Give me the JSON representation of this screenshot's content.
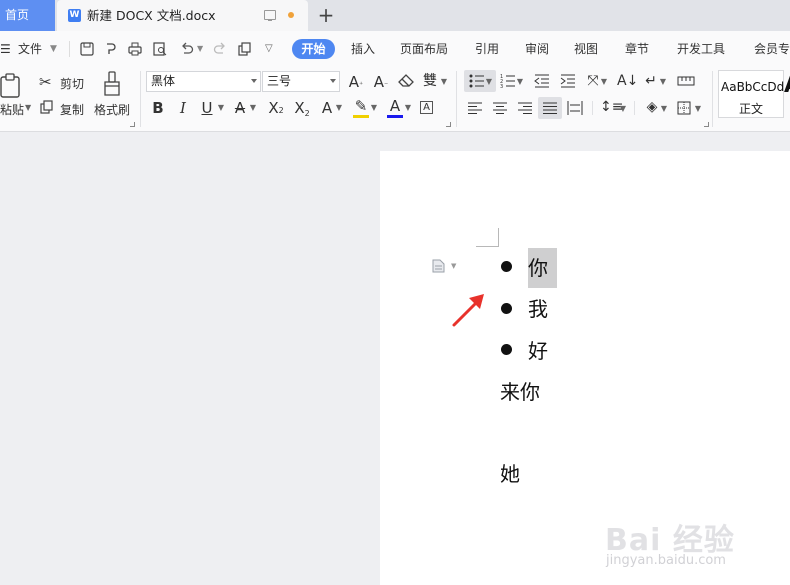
{
  "tabs": {
    "home": "首页",
    "doc_icon_letter": "W",
    "doc_title": "新建 DOCX 文档.docx",
    "new_tab": "+"
  },
  "menu": {
    "file": "文件",
    "tabs": [
      "开始",
      "插入",
      "页面布局",
      "引用",
      "审阅",
      "视图",
      "章节",
      "开发工具",
      "会员专"
    ],
    "active": "开始"
  },
  "ribbon": {
    "paste": "粘贴",
    "cut": "剪切",
    "copy": "复制",
    "format_painter": "格式刷",
    "font_family": "黑体",
    "font_size": "三号",
    "style_preview": "AaBbCcDd",
    "style_name": "正文",
    "style_next": "A"
  },
  "document": {
    "bullets": [
      "你",
      "我",
      "好"
    ],
    "lines": [
      "来你",
      "她"
    ]
  },
  "watermark": {
    "brand": "Bai 经验",
    "url": "jingyan.baidu.com"
  },
  "colors": {
    "accent": "#4e87f1",
    "home_tab": "#5e8ff2",
    "arrow": "#e8322b",
    "font_color_bar": "#1a1aee",
    "highlight_bar": "#f0d000"
  }
}
